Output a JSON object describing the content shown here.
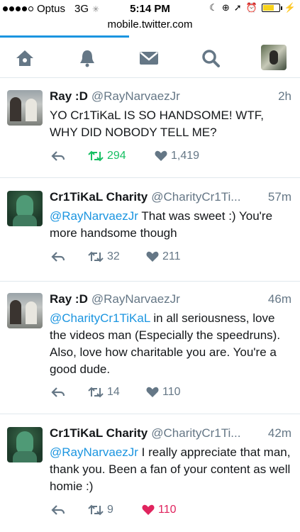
{
  "status_bar": {
    "carrier": "Optus",
    "network": "3G",
    "time": "5:14 PM",
    "url": "mobile.twitter.com"
  },
  "nav": {
    "items": [
      "home-icon",
      "notifications-icon",
      "messages-icon",
      "search-icon",
      "profile-avatar"
    ],
    "load_progress": 0.43
  },
  "tweets": [
    {
      "name": "Ray :D",
      "handle": "@RayNarvaezJr",
      "time": "2h",
      "text": "YO Cr1TiKaL IS SO HANDSOME! WTF, WHY DID NOBODY TELL ME?",
      "retweets": "294",
      "likes": "1,419",
      "retweeted": true,
      "liked": false
    },
    {
      "name": "Cr1TiKaL Charity",
      "handle": "@CharityCr1Ti...",
      "time": "57m",
      "mention": "@RayNarvaezJr",
      "text": " That was sweet :) You're more handsome though",
      "retweets": "32",
      "likes": "211",
      "retweeted": false,
      "liked": false
    },
    {
      "name": "Ray :D",
      "handle": "@RayNarvaezJr",
      "time": "46m",
      "mention": "@CharityCr1TiKaL",
      "text": " in all seriousness, love the videos man (Especially the speedruns). Also, love how charitable you are. You're a good dude.",
      "retweets": "14",
      "likes": "110",
      "retweeted": false,
      "liked": false
    },
    {
      "name": "Cr1TiKaL Charity",
      "handle": "@CharityCr1Ti...",
      "time": "42m",
      "mention": "@RayNarvaezJr",
      "text": " I really appreciate that man, thank you. Been a fan of your content as well homie :)",
      "retweets": "9",
      "likes": "110",
      "retweeted": false,
      "liked": true
    }
  ],
  "colors": {
    "accent": "#1b95e0",
    "retweet_active": "#17bf63",
    "like_active": "#e0245e",
    "muted": "#657786"
  }
}
